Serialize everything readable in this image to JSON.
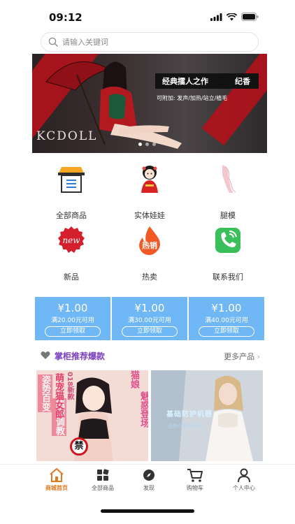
{
  "status_bar": {
    "time": "09:12"
  },
  "search": {
    "placeholder": "请输入关键词"
  },
  "banner": {
    "brand": "KCDOLL",
    "headline_left": "经典擂人之作",
    "headline_right": "纪香",
    "options_prefix": "可附加:",
    "options": "发声/加热/站立/植毛"
  },
  "categories": [
    {
      "label": "全部商品",
      "icon": "all-products-icon"
    },
    {
      "label": "实体娃娃",
      "icon": "doll-icon"
    },
    {
      "label": "腿模",
      "icon": "leg-model-icon"
    },
    {
      "label": "新品",
      "icon": "new-icon"
    },
    {
      "label": "热卖",
      "icon": "hot-sale-icon"
    },
    {
      "label": "联系我们",
      "icon": "phone-icon"
    }
  ],
  "coupons": [
    {
      "amount": "¥1.00",
      "condition": "满20.00元可用",
      "button": "立即领取"
    },
    {
      "amount": "¥1.00",
      "condition": "满30.00元可用",
      "button": "立即领取"
    },
    {
      "amount": "¥1.00",
      "condition": "满40.00元可用",
      "button": "立即领取"
    }
  ],
  "recommend": {
    "title": "掌柜推荐爆款",
    "more": "更多产品"
  },
  "products": [
    {
      "col1": "姿势百变",
      "col2": "随你调教",
      "col3": "萌宠猫女郎",
      "col4": "018新款",
      "badge": "禁",
      "right_col1": "猫娘",
      "right_col2": "魅惑登场"
    },
    {
      "title": "基础防护机器",
      "subtitle": "全新AI智能系统"
    }
  ],
  "tabs": [
    {
      "label": "商城首页",
      "icon": "home-icon",
      "active": true
    },
    {
      "label": "全部商品",
      "icon": "grid-icon",
      "active": false
    },
    {
      "label": "发现",
      "icon": "compass-icon",
      "active": false
    },
    {
      "label": "购物车",
      "icon": "cart-icon",
      "active": false
    },
    {
      "label": "个人中心",
      "icon": "user-icon",
      "active": false
    }
  ],
  "colors": {
    "accent": "#e07a1f",
    "coupon": "#6fb8f5",
    "recommend_title": "#7a3fbf",
    "banner_red": "#b3121b"
  }
}
